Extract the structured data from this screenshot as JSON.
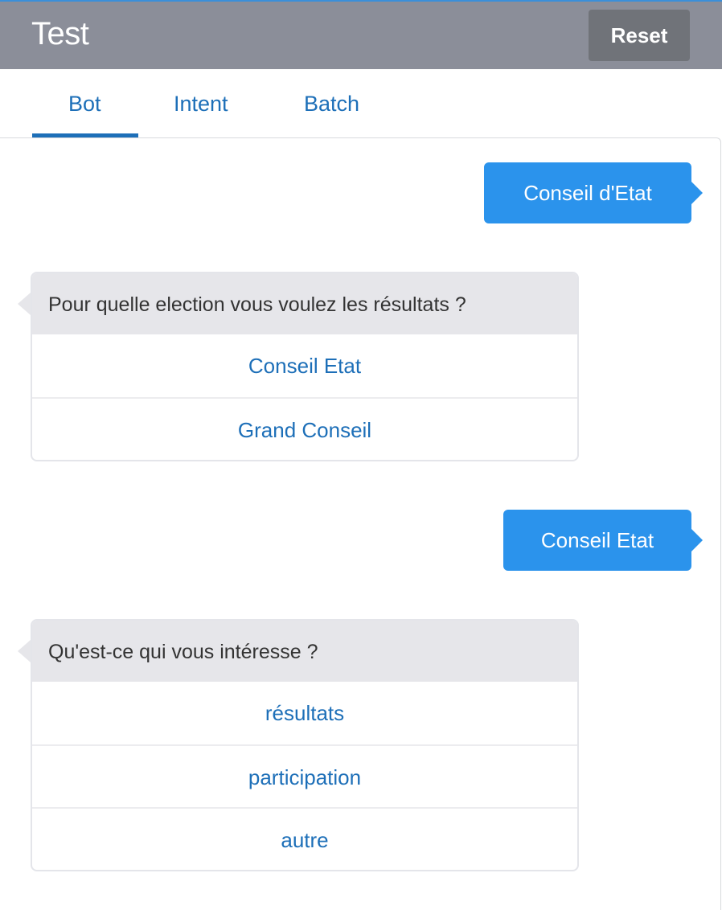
{
  "header": {
    "title": "Test",
    "reset_label": "Reset"
  },
  "tabs": [
    {
      "label": "Bot",
      "active": true
    },
    {
      "label": "Intent",
      "active": false
    },
    {
      "label": "Batch",
      "active": false
    }
  ],
  "conversation": {
    "messages": [
      {
        "from": "user",
        "text": "Conseil d'Etat"
      },
      {
        "from": "bot",
        "text": "Pour quelle election vous voulez les résultats ?",
        "choices": [
          "Conseil Etat",
          "Grand Conseil"
        ]
      },
      {
        "from": "user",
        "text": "Conseil Etat"
      },
      {
        "from": "bot",
        "text": "Qu'est-ce qui vous intéresse ?",
        "choices": [
          "résultats",
          "participation",
          "autre"
        ]
      }
    ]
  },
  "colors": {
    "header_bg": "#8b8e99",
    "reset_bg": "#707379",
    "accent": "#1d6fb8",
    "user_bubble": "#2b93ec",
    "bot_question_bg": "#e6e6ea"
  }
}
